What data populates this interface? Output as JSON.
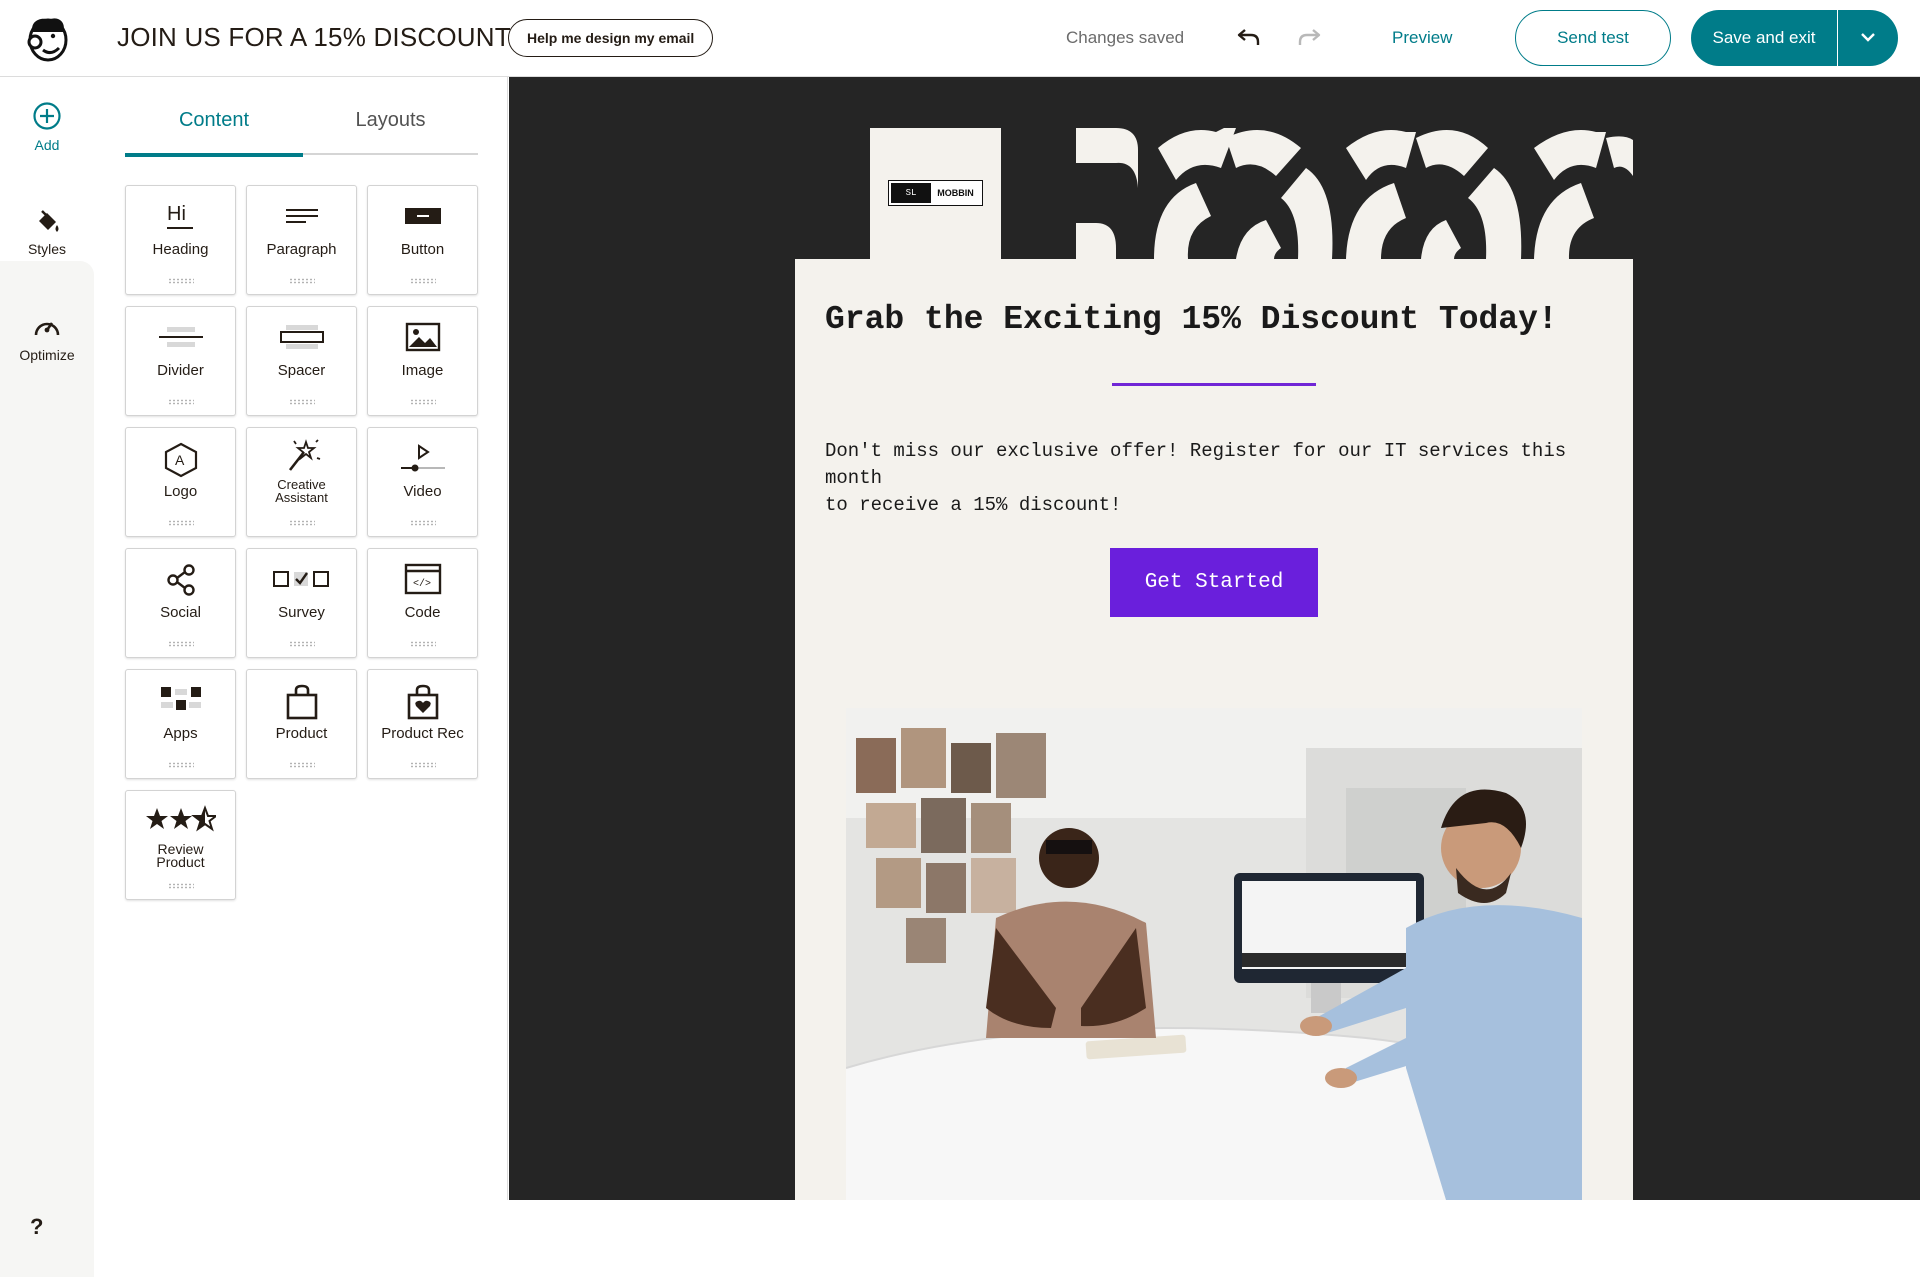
{
  "header": {
    "title": "JOIN US FOR A 15% DISCOUNT",
    "help_button": "Help me design my email",
    "status": "Changes saved",
    "preview": "Preview",
    "send_test": "Send test",
    "save_exit": "Save and exit"
  },
  "rail": {
    "add": "Add",
    "styles": "Styles",
    "optimize": "Optimize",
    "help": "?"
  },
  "panel": {
    "tabs": [
      "Content",
      "Layouts"
    ],
    "blocks": [
      {
        "label": "Heading",
        "icon": "heading-icon"
      },
      {
        "label": "Paragraph",
        "icon": "paragraph-icon"
      },
      {
        "label": "Button",
        "icon": "button-icon"
      },
      {
        "label": "Divider",
        "icon": "divider-icon"
      },
      {
        "label": "Spacer",
        "icon": "spacer-icon"
      },
      {
        "label": "Image",
        "icon": "image-icon"
      },
      {
        "label": "Logo",
        "icon": "logo-icon"
      },
      {
        "label": "Creative Assistant",
        "icon": "magic-wand-icon"
      },
      {
        "label": "Video",
        "icon": "video-icon"
      },
      {
        "label": "Social",
        "icon": "share-icon"
      },
      {
        "label": "Survey",
        "icon": "survey-icon"
      },
      {
        "label": "Code",
        "icon": "code-icon"
      },
      {
        "label": "Apps",
        "icon": "apps-icon"
      },
      {
        "label": "Product",
        "icon": "shopping-bag-icon"
      },
      {
        "label": "Product Rec",
        "icon": "product-rec-icon"
      },
      {
        "label": "Review Product",
        "icon": "stars-icon"
      }
    ]
  },
  "email": {
    "logo_left": "SL",
    "logo_right": "MOBBIN",
    "heading": "Grab the Exciting 15% Discount Today!",
    "body_line1": "Don't miss our exclusive offer! Register for our IT services this month",
    "body_line2": "to receive a 15% discount!",
    "cta": "Get Started",
    "accent_color": "#6a1fdc"
  },
  "colors": {
    "brand_teal": "#007c89",
    "canvas_dark": "#252525",
    "email_bg": "#f4f2ed"
  }
}
